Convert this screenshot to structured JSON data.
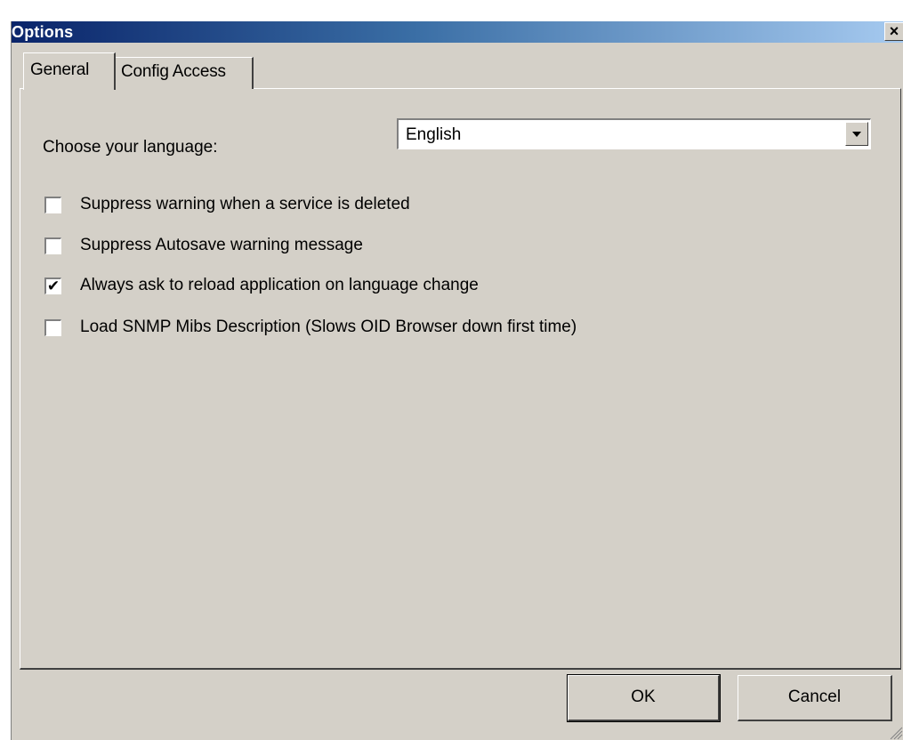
{
  "window": {
    "title": "Options",
    "close_glyph": "×"
  },
  "tabs": [
    {
      "label": "General",
      "active": true
    },
    {
      "label": "Config Access",
      "active": false
    }
  ],
  "general": {
    "language_label": "Choose your language:",
    "language_value": "English",
    "options": [
      {
        "label": "Suppress warning when a service is deleted",
        "checked": false
      },
      {
        "label": "Suppress Autosave warning message",
        "checked": false
      },
      {
        "label": "Always ask to reload application on language change",
        "checked": true
      },
      {
        "label": "Load SNMP Mibs Description  (Slows OID Browser down first time)",
        "checked": false
      }
    ]
  },
  "buttons": {
    "ok": "OK",
    "cancel": "Cancel"
  },
  "icons": {
    "close": "close-icon",
    "dropdown": "chevron-down-icon",
    "checkmark": "checkmark-icon",
    "resize": "resize-grip-icon"
  },
  "colors": {
    "dialog_bg": "#d4d0c8",
    "title_start": "#0a246a",
    "title_end": "#a6caf0"
  }
}
